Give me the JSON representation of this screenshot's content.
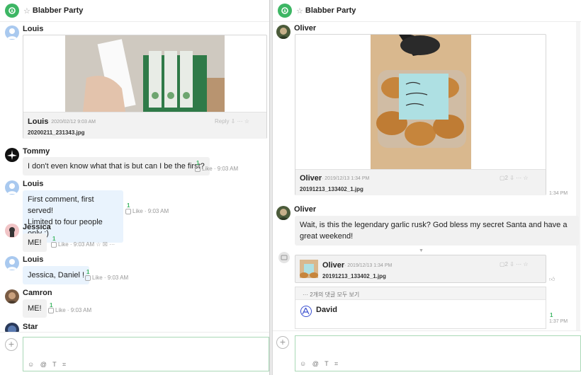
{
  "left": {
    "title": "Blabber Party",
    "msgs": {
      "louis1_name": "Louis",
      "card_name": "Louis",
      "card_date": "· 2020/02/12 9:03 AM",
      "card_tools": "Reply ⇩ ··· ☆",
      "card_file": "20200211_231343.jpg",
      "tommy_name": "Tommy",
      "tommy_text": "I don't even know what that is but can I be the first?",
      "tommy_like_count": "1",
      "tommy_meta": "Like · 9:03 AM",
      "louis2_name": "Louis",
      "louis2_line1": "First comment, first served!",
      "louis2_line2": "Limited to four people only ;)",
      "louis2_like_count": "1",
      "louis2_meta": "Like · 9:03 AM",
      "jessica_name": "Jessica",
      "jessica_text": "ME!",
      "jessica_like_count": "1",
      "jessica_meta": "Like · 9:03 AM ☆ ☒ ···",
      "louis3_name": "Louis",
      "louis3_text": "Jessica, Daniel !",
      "louis3_like_count": "1",
      "louis3_meta": "Like · 9:03 AM",
      "camron_name": "Camron",
      "camron_text": "ME!",
      "camron_like_count": "1",
      "camron_meta": "Like · 9:03 AM",
      "star_name": "Star"
    },
    "composer_tools": "☺ @ T ⌗"
  },
  "right": {
    "title": "Blabber Party",
    "oliver1_name": "Oliver",
    "card1_name": "Oliver",
    "card1_date": "· 2019/12/13 1:34 PM",
    "card1_tools": "▢2 ⇩ ··· ☆",
    "card1_file": "20191213_133402_1.jpg",
    "card1_time": "1:34 PM",
    "oliver2_name": "Oliver",
    "oliver2_text": "Wait, is this the legendary garlic rusk?  God bless my secret Santa and have a great weekend!",
    "card2_name": "Oliver",
    "card2_date": "· 2019/12/13 1:34 PM",
    "card2_tools": "▢2 ⇩ ··· ☆",
    "card2_file": "20191213_133402_1.jpg",
    "replies_link": "··· 2개의 댓글 모두 보기",
    "david_name": "David",
    "david_like_count": "1",
    "david_time": "1:37 PM",
    "composer_tools": "☺ @ T ⌗"
  },
  "colors": {
    "accent": "#3db664",
    "bubble": "#f1f1f1",
    "bubble_blue": "#e9f3fd"
  }
}
